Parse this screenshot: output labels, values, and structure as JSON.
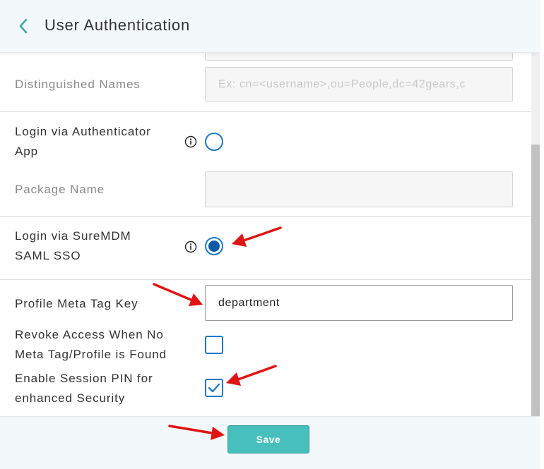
{
  "header": {
    "title": "User Authentication"
  },
  "form": {
    "distinguished_names": {
      "label": "Distinguished Names",
      "placeholder": "Ex: cn=<username>,ou=People,dc=42gears,c"
    },
    "authenticator_app": {
      "label_line1": "Login via Authenticator",
      "label_line2": "App",
      "selected": false
    },
    "package_name": {
      "label": "Package Name",
      "value": ""
    },
    "suremdm_saml": {
      "label_line1": "Login via SureMDM",
      "label_line2": "SAML SSO",
      "selected": true
    },
    "profile_meta_tag_key": {
      "label": "Profile Meta Tag Key",
      "value": "department"
    },
    "revoke_access": {
      "label_line1": "Revoke Access When No",
      "label_line2": "Meta Tag/Profile is Found",
      "checked": false
    },
    "session_pin": {
      "label_line1": "Enable Session PIN for",
      "label_line2": "enhanced Security",
      "checked": true
    }
  },
  "footer": {
    "save_label": "Save"
  },
  "colors": {
    "accent": "#1e78c8",
    "save_button": "#46bfbd",
    "annotation_arrow": "#e01414"
  },
  "icons": [
    "chevron-left-icon",
    "chevron-down-icon",
    "info-icon",
    "checkmark-icon",
    "arrow-annotation"
  ]
}
